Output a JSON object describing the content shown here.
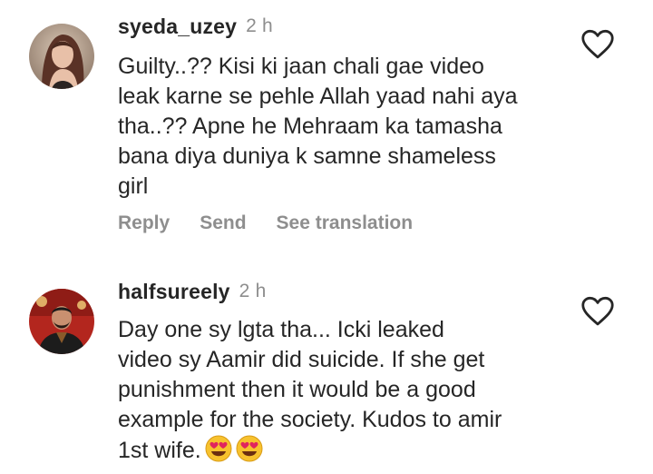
{
  "comments": [
    {
      "username": "syeda_uzey",
      "time": "2 h",
      "text": "Guilty..?? Kisi ki jaan chali gae video\nleak karne se pehle Allah yaad nahi aya\ntha..?? Apne he Mehraam ka tamasha\nbana diya duniya k samne shameless\ngirl",
      "actions": [
        "Reply",
        "Send",
        "See translation"
      ],
      "avatar_icon": "user-avatar-woman",
      "like_icon": "heart-outline-icon"
    },
    {
      "username": "halfsureely",
      "time": "2 h",
      "text": "Day one sy lgta tha... Icki leaked\nvideo sy Aamir did suicide. If she get\npunishment then it would be a good\nexample for the society. Kudos to amir\n1st wife.",
      "emojis": [
        "heart-eyes-emoji",
        "heart-eyes-emoji"
      ],
      "avatar_icon": "user-avatar-man",
      "like_icon": "heart-outline-icon"
    }
  ],
  "colors": {
    "text": "#262626",
    "muted": "#8e8e8e",
    "background": "#ffffff"
  }
}
